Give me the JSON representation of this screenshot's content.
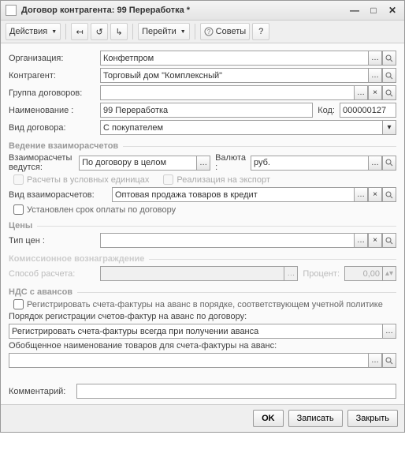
{
  "window": {
    "title": "Договор контрагента: 99 Переработка *"
  },
  "toolbar": {
    "actions": "Действия",
    "goto": "Перейти",
    "advice": "Советы"
  },
  "fields": {
    "organization_label": "Организация:",
    "organization": "Конфетпром",
    "counterparty_label": "Контрагент:",
    "counterparty": "Торговый дом \"Комплексный\"",
    "contract_group_label": "Группа договоров:",
    "contract_group": "",
    "name_label": "Наименование :",
    "name": "99 Переработка",
    "code_label": "Код:",
    "code": "000000127",
    "contract_type_label": "Вид договора:",
    "contract_type": "С покупателем"
  },
  "settlements": {
    "section": "Ведение взаиморасчетов",
    "mode_label": "Взаиморасчеты ведутся:",
    "mode": "По договору в целом",
    "currency_label": "Валюта :",
    "currency": "руб.",
    "chk1": "Расчеты в условных единицах",
    "chk2": "Реализация на экспорт",
    "kind_label": "Вид взаиморасчетов:",
    "kind": "Оптовая продажа товаров в кредит",
    "chk3": "Установлен срок оплаты по договору"
  },
  "prices": {
    "section": "Цены",
    "type_label": "Тип цен :",
    "type": ""
  },
  "commission": {
    "section": "Комиссионное вознаграждение",
    "method_label": "Способ расчета:",
    "method": "",
    "percent_label": "Процент:",
    "percent": "0,00"
  },
  "vat": {
    "section": "НДС с авансов",
    "chk": "Регистрировать счета-фактуры на аванс в порядке, соответствующем учетной политике",
    "order_label": "Порядок регистрации счетов-фактур на аванс по договору:",
    "order": "Регистрировать счета-фактуры всегда при получении аванса",
    "summary_label": "Обобщенное наименование товаров для счета-фактуры на аванс:",
    "summary": ""
  },
  "comment": {
    "label": "Комментарий:",
    "value": ""
  },
  "buttons": {
    "ok": "OK",
    "save": "Записать",
    "close": "Закрыть"
  }
}
